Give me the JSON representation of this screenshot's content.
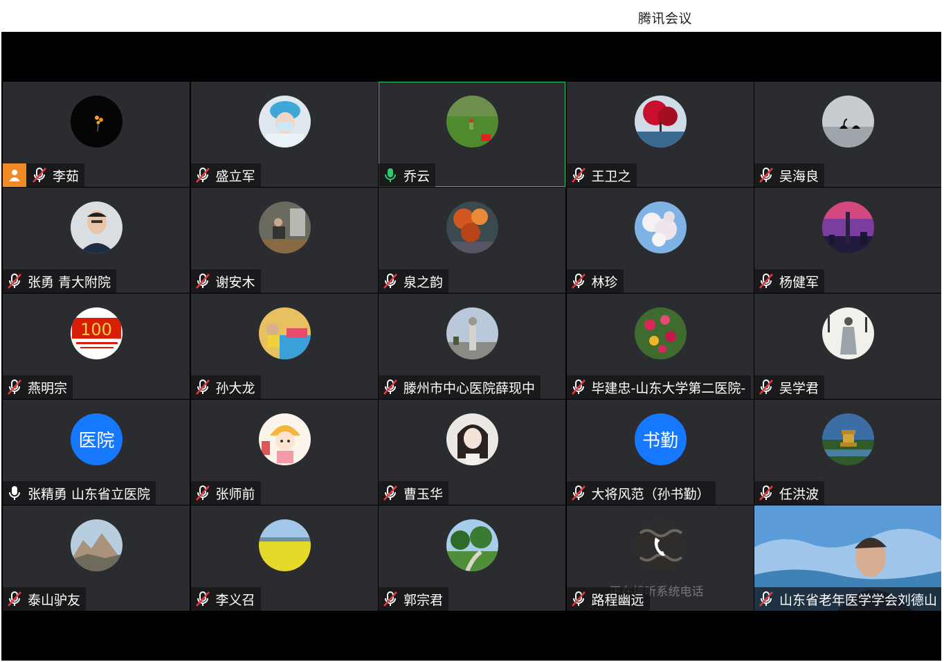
{
  "window": {
    "title": "腾讯会议"
  },
  "participants": [
    {
      "name": "李茹",
      "mic": "muted",
      "host": true,
      "avatar": "sunflower-dark"
    },
    {
      "name": "盛立军",
      "mic": "muted",
      "avatar": "nurse-photo"
    },
    {
      "name": "乔云",
      "mic": "speaking",
      "speaking": true,
      "avatar": "field-photo"
    },
    {
      "name": "王卫之",
      "mic": "muted",
      "avatar": "red-tree-photo"
    },
    {
      "name": "吴海良",
      "mic": "muted",
      "avatar": "swan-photo"
    },
    {
      "name": "张勇 青大附院",
      "mic": "muted",
      "avatar": "man-portrait"
    },
    {
      "name": "谢安木",
      "mic": "muted",
      "avatar": "man-sitting-photo"
    },
    {
      "name": "泉之韵",
      "mic": "muted",
      "avatar": "autumn-leaves-photo"
    },
    {
      "name": "林珍",
      "mic": "muted",
      "avatar": "blossom-photo"
    },
    {
      "name": "杨健军",
      "mic": "muted",
      "avatar": "sunset-city-photo"
    },
    {
      "name": "燕明宗",
      "mic": "muted",
      "avatar": "party-100-logo"
    },
    {
      "name": "孙大龙",
      "mic": "muted",
      "avatar": "child-photo"
    },
    {
      "name": "滕州市中心医院薛现中",
      "mic": "muted",
      "avatar": "monument-photo"
    },
    {
      "name": "毕建忠-山东大学第二医院-",
      "mic": "muted",
      "avatar": "flowers-photo"
    },
    {
      "name": "吴学君",
      "mic": "muted",
      "avatar": "calligraphy-figure"
    },
    {
      "name": "张精勇  山东省立医院",
      "mic": "on",
      "avatar": "text",
      "avatar_text": "医院"
    },
    {
      "name": "张师前",
      "mic": "muted",
      "avatar": "cartoon-girl"
    },
    {
      "name": "曹玉华",
      "mic": "muted",
      "avatar": "girl-portrait"
    },
    {
      "name": "大将风范（孙书勤）",
      "mic": "muted",
      "avatar": "text",
      "avatar_text": "书勤"
    },
    {
      "name": "任洪波",
      "mic": "muted",
      "avatar": "pagoda-photo"
    },
    {
      "name": "泰山驴友",
      "mic": "muted",
      "avatar": "mountain-photo"
    },
    {
      "name": "李义召",
      "mic": "muted",
      "avatar": "rapeseed-field-photo"
    },
    {
      "name": "郭宗君",
      "mic": "muted",
      "avatar": "garden-photo"
    },
    {
      "name": "路程幽远",
      "mic": "muted",
      "avatar": "phone-call",
      "status_text": "正在接听系统电话"
    },
    {
      "name": "山东省老年医学学会刘德山",
      "mic": "muted",
      "video": true
    }
  ],
  "colors": {
    "tile_bg": "#2b2c2f",
    "speaking_border": "#2ecc71",
    "host_badge": "#f08a24",
    "text_avatar_bg": "#1677ff",
    "mic_muted": "#e5393d"
  }
}
